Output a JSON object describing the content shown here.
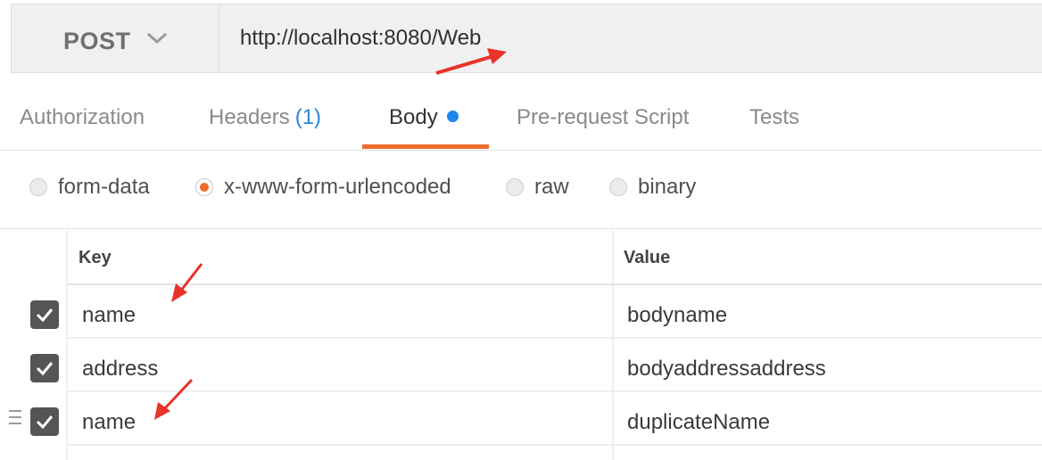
{
  "request": {
    "method": "POST",
    "url": "http://localhost:8080/Web"
  },
  "tabs": {
    "authorization": "Authorization",
    "headers": "Headers",
    "headers_count": "(1)",
    "body": "Body",
    "prerequest": "Pre-request Script",
    "tests": "Tests"
  },
  "body_types": {
    "form_data": "form-data",
    "urlencoded": "x-www-form-urlencoded",
    "raw": "raw",
    "binary": "binary",
    "selected": "x-www-form-urlencoded"
  },
  "table": {
    "headers": {
      "key": "Key",
      "value": "Value"
    },
    "rows": [
      {
        "key": "name",
        "value": "bodyname",
        "checked": true
      },
      {
        "key": "address",
        "value": "bodyaddressaddress",
        "checked": true
      },
      {
        "key": "name",
        "value": "duplicateName",
        "checked": true
      }
    ]
  },
  "colors": {
    "accent": "#ef6c2c",
    "dot": "#1f85e8",
    "annotation_arrow": "#e8322a"
  },
  "icons": [
    "chevron-down-icon",
    "check-icon",
    "drag-handle-icon",
    "unsaved-dot-icon"
  ]
}
